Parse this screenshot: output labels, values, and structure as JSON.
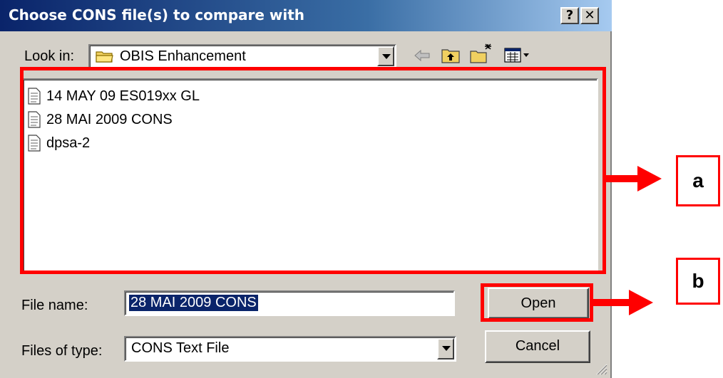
{
  "window": {
    "title": "Choose CONS file(s) to compare with",
    "help_label": "?",
    "close_label": "✕"
  },
  "look_in": {
    "label": "Look in:",
    "value": "OBIS Enhancement"
  },
  "toolbar": {
    "icons": [
      "back-arrow-icon",
      "up-one-level-icon",
      "new-folder-icon",
      "view-menu-icon"
    ]
  },
  "files": [
    {
      "name": "14 MAY 09 ES019xx GL"
    },
    {
      "name": "28 MAI 2009 CONS"
    },
    {
      "name": "dpsa-2"
    }
  ],
  "file_name": {
    "label": "File name:",
    "value": "28 MAI 2009 CONS"
  },
  "file_type": {
    "label": "Files of type:",
    "value": "CONS Text File"
  },
  "buttons": {
    "open": "Open",
    "cancel": "Cancel"
  },
  "annotations": {
    "a": "a",
    "b": "b",
    "color": "#ff0000"
  }
}
